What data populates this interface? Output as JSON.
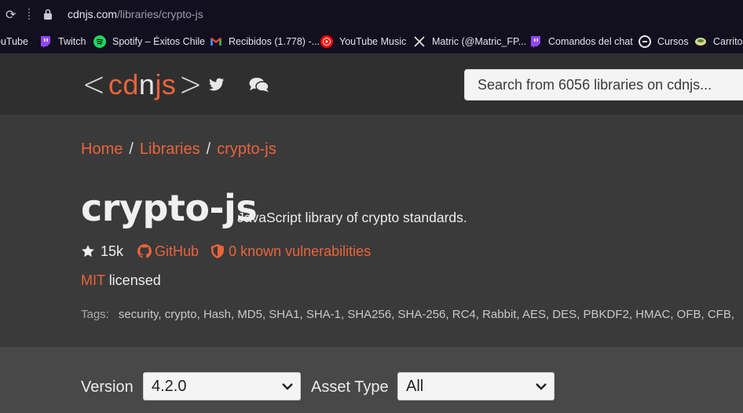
{
  "browser": {
    "url_host": "cdnjs.com",
    "url_path": "/libraries/crypto-js",
    "bookmarks": [
      {
        "label": "ouTube",
        "icon": "youtube-icon"
      },
      {
        "label": "Twitch",
        "icon": "twitch-icon"
      },
      {
        "label": "Spotify – Éxitos Chile",
        "icon": "spotify-icon"
      },
      {
        "label": "Recibidos (1.778) -...",
        "icon": "gmail-icon"
      },
      {
        "label": "YouTube Music",
        "icon": "youtube-music-icon"
      },
      {
        "label": "Matric (@Matric_FP...",
        "icon": "x-icon"
      },
      {
        "label": "Comandos del chat",
        "icon": "twitch-icon"
      },
      {
        "label": "Cursos",
        "icon": "edx-icon"
      },
      {
        "label": "Carrito",
        "icon": "cart-icon"
      }
    ]
  },
  "header": {
    "logo_left": "<",
    "logo_cdn_1": "cd",
    "logo_n": "n",
    "logo_js": "js",
    "logo_right": ">",
    "search_placeholder": "Search from 6056 libraries on cdnjs..."
  },
  "breadcrumb": {
    "home": "Home",
    "sep1": "/",
    "libraries": "Libraries",
    "sep2": "/",
    "current": "crypto-js"
  },
  "library": {
    "name": "crypto-js",
    "description": "JavaScript library of crypto standards.",
    "stars": "15k",
    "github_label": "GitHub",
    "vulnerabilities": "0 known vulnerabilities",
    "license": "MIT",
    "license_suffix": "licensed",
    "tags_label": "Tags:",
    "tags": "security, crypto, Hash, MD5, SHA1, SHA-1, SHA256, SHA-256, RC4, Rabbit, AES, DES, PBKDF2, HMAC, OFB, CFB,"
  },
  "filters": {
    "version_label": "Version",
    "version_value": "4.2.0",
    "asset_type_label": "Asset Type",
    "asset_type_value": "All"
  },
  "colors": {
    "accent": "#e9643b",
    "header_bg": "#2f2f2f",
    "main_bg": "#3a3a3a",
    "filter_bg": "#484848"
  }
}
